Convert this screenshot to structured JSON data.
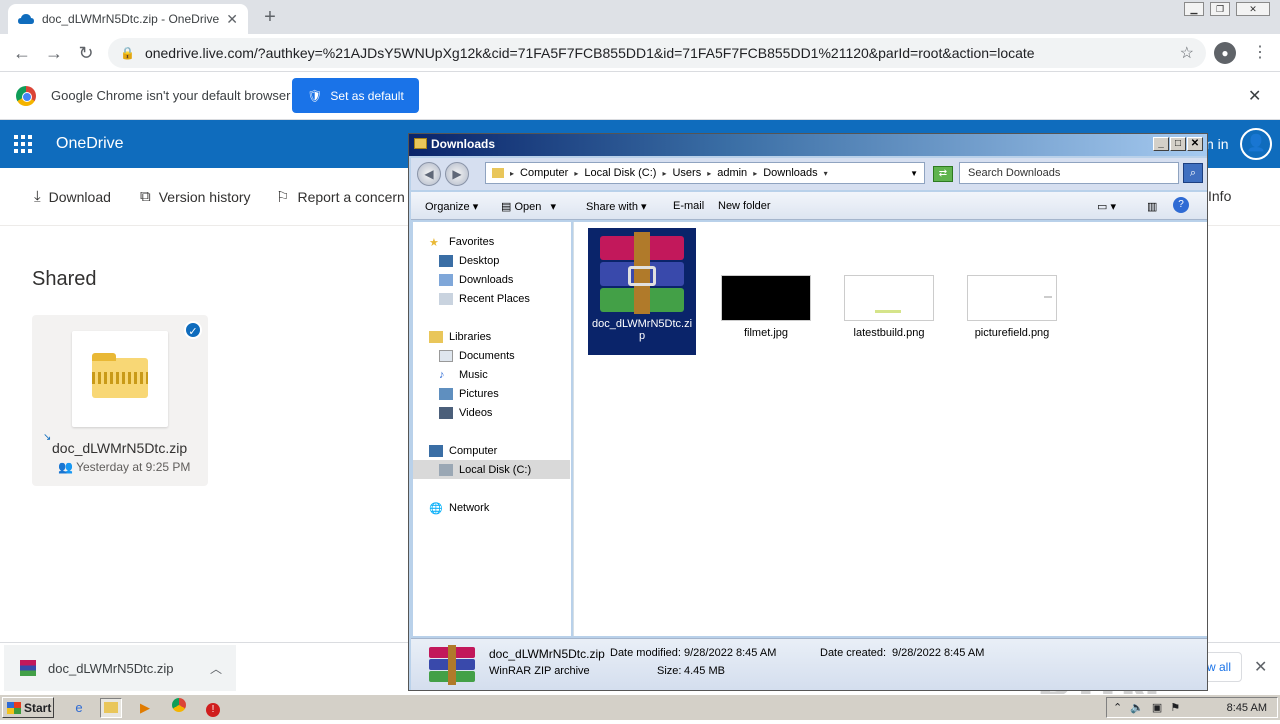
{
  "browser": {
    "tab_title": "doc_dLWMrN5Dtc.zip - OneDrive",
    "new_tab_label": "+",
    "url": "onedrive.live.com/?authkey=%21AJDsY5WNUpXg12k&cid=71FA5F7FCB855DD1&id=71FA5F7FCB855DD1%21120&parId=root&action=locate"
  },
  "infobar": {
    "message": "Google Chrome isn't your default browser",
    "set_default_label": "Set as default"
  },
  "onedrive": {
    "brand": "OneDrive",
    "sign_in": "n in",
    "commands": {
      "download": "Download",
      "version_history": "Version history",
      "report": "Report a concern",
      "info": "Info"
    },
    "section_title": "Shared",
    "file": {
      "name": "doc_dLWMrN5Dtc.zip",
      "meta": "Yesterday at 9:25 PM"
    }
  },
  "explorer": {
    "title": "Downloads",
    "breadcrumb": [
      "Computer",
      "Local Disk (C:)",
      "Users",
      "admin",
      "Downloads"
    ],
    "search_placeholder": "Search Downloads",
    "toolbar": {
      "organize": "Organize",
      "open": "Open",
      "share_with": "Share with",
      "email": "E-mail",
      "new_folder": "New folder"
    },
    "nav": {
      "favorites": "Favorites",
      "desktop": "Desktop",
      "downloads": "Downloads",
      "recent_places": "Recent Places",
      "libraries": "Libraries",
      "documents": "Documents",
      "music": "Music",
      "pictures": "Pictures",
      "videos": "Videos",
      "computer": "Computer",
      "local_disk": "Local Disk (C:)",
      "network": "Network"
    },
    "files": [
      {
        "name": "doc_dLWMrN5Dtc.zip"
      },
      {
        "name": "filmet.jpg"
      },
      {
        "name": "latestbuild.png"
      },
      {
        "name": "picturefield.png"
      }
    ],
    "status": {
      "name": "doc_dLWMrN5Dtc.zip",
      "date_modified_label": "Date modified:",
      "date_modified": "9/28/2022 8:45 AM",
      "date_created_label": "Date created:",
      "date_created": "9/28/2022 8:45 AM",
      "type": "WinRAR ZIP archive",
      "size_label": "Size:",
      "size": "4.45 MB"
    }
  },
  "shelf": {
    "item_name": "doc_dLWMrN5Dtc.zip",
    "show_all": "w all"
  },
  "watermark": "ANY RUN",
  "taskbar": {
    "start": "Start",
    "clock": "8:45 AM"
  }
}
